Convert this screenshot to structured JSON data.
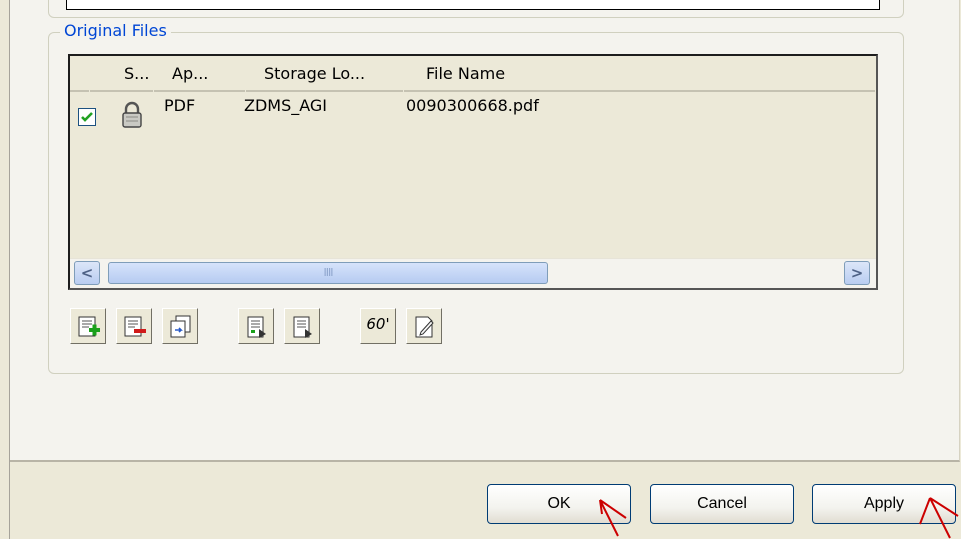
{
  "original_files": {
    "legend": "Original Files",
    "columns": [
      "S...",
      "Ap...",
      "Storage Lo...",
      "File Name"
    ],
    "rows": [
      {
        "checked": true,
        "status_icon": "lock-icon",
        "application": "PDF",
        "storage_location": "ZDMS_AGI",
        "file_name": "0090300668.pdf"
      }
    ],
    "scrollbar": {
      "left_glyph": "<",
      "thumb_grip": "IIII",
      "right_glyph": ">"
    }
  },
  "toolbar": {
    "icons": [
      "add-file-icon",
      "delete-file-icon",
      "copy-file-icon",
      "check-in-icon",
      "check-out-icon",
      "display-glasses-icon",
      "edit-icon"
    ],
    "display_glyph": "60'"
  },
  "buttons": {
    "ok": "OK",
    "cancel": "Cancel",
    "apply": "Apply"
  },
  "colors": {
    "legend": "#0046d5",
    "dialog_bg": "#ece9d8",
    "annotation": "#cc0000"
  }
}
